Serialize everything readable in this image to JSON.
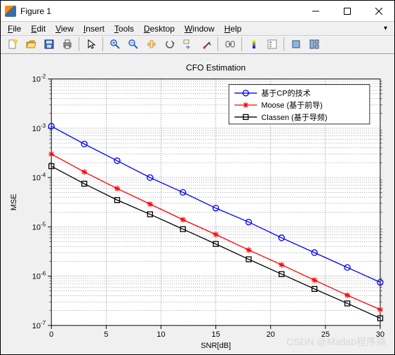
{
  "window": {
    "title": "Figure 1"
  },
  "menu": {
    "file": "File",
    "file_u": "F",
    "edit": "Edit",
    "edit_u": "E",
    "view": "View",
    "view_u": "V",
    "insert": "Insert",
    "insert_u": "I",
    "tools": "Tools",
    "tools_u": "T",
    "desktop": "Desktop",
    "desktop_u": "D",
    "window": "Window",
    "window_u": "W",
    "help": "Help",
    "help_u": "H"
  },
  "toolbar_icons": {
    "new": "new-icon",
    "open": "open-icon",
    "save": "save-icon",
    "print": "print-icon",
    "pointer": "pointer-icon",
    "zoomin": "zoom-in-icon",
    "zoomout": "zoom-out-icon",
    "pan": "pan-icon",
    "rotate": "rotate-icon",
    "datacursor": "data-cursor-icon",
    "brush": "brush-icon",
    "link": "link-icon",
    "colorbar": "colorbar-icon",
    "legend": "legend-icon",
    "hide": "hide-plot-tools-icon",
    "show": "show-plot-tools-icon"
  },
  "chart_data": {
    "type": "line",
    "title": "CFO Estimation",
    "xlabel": "SNR[dB]",
    "ylabel": "MSE",
    "xlim": [
      0,
      30
    ],
    "ylim": [
      1e-07,
      0.01
    ],
    "xticks": [
      0,
      5,
      10,
      15,
      20,
      25,
      30
    ],
    "yticks_exp": [
      -7,
      -6,
      -5,
      -4,
      -3,
      -2
    ],
    "x": [
      0,
      3,
      6,
      9,
      12,
      15,
      18,
      21,
      24,
      27,
      30
    ],
    "series": [
      {
        "name": "基于CP的技术",
        "color": "#0000ff",
        "marker": "circle",
        "values": [
          0.0011,
          0.00048,
          0.00022,
          0.0001,
          5e-05,
          2.4e-05,
          1.25e-05,
          6e-06,
          3e-06,
          1.5e-06,
          7.5e-07
        ]
      },
      {
        "name": "Moose (基于前导)",
        "color": "#ff0000",
        "marker": "star",
        "values": [
          0.0003,
          0.00013,
          6e-05,
          2.9e-05,
          1.4e-05,
          7e-06,
          3.4e-06,
          1.7e-06,
          8.3e-07,
          4.1e-07,
          2.1e-07
        ]
      },
      {
        "name": "Classen (基于导频)",
        "color": "#000000",
        "marker": "square",
        "values": [
          0.00017,
          7.5e-05,
          3.5e-05,
          1.8e-05,
          9e-06,
          4.5e-06,
          2.2e-06,
          1.1e-06,
          5.5e-07,
          2.8e-07,
          1.4e-07
        ]
      }
    ],
    "legend_position": "upper-right"
  },
  "watermark": "CSDN @Matlab程序猿"
}
